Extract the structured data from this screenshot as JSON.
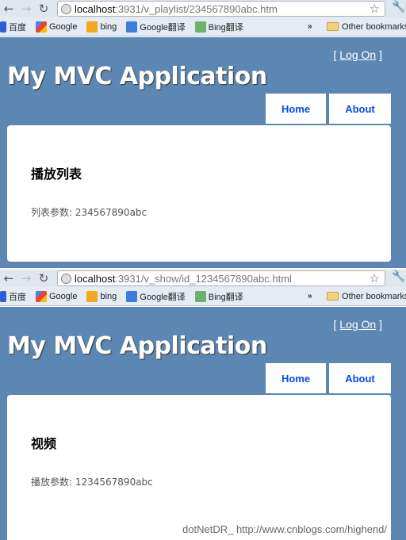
{
  "bookmarks": [
    "百度",
    "Google",
    "bing",
    "Google翻译",
    "Bing翻译"
  ],
  "other_bookmarks": "Other bookmarks",
  "overflow": "»",
  "screens": [
    {
      "url_host": "localhost",
      "url_path": ":3931/v_playlist/234567890abc.htm",
      "logon": "Log On",
      "title": "My MVC Application",
      "tabs": [
        "Home",
        "About"
      ],
      "heading": "播放列表",
      "text": "列表参数: 234567890abc"
    },
    {
      "url_host": "localhost",
      "url_path": ":3931/v_show/id_1234567890abc.html",
      "logon": "Log On",
      "title": "My MVC Application",
      "tabs": [
        "Home",
        "About"
      ],
      "heading": "视频",
      "text": "播放参数: 1234567890abc"
    }
  ],
  "watermark": "dotNetDR_  http://www.cnblogs.com/highend/",
  "colors": {
    "header_bg": "#5c87b2",
    "tab_text": "#034af3"
  }
}
